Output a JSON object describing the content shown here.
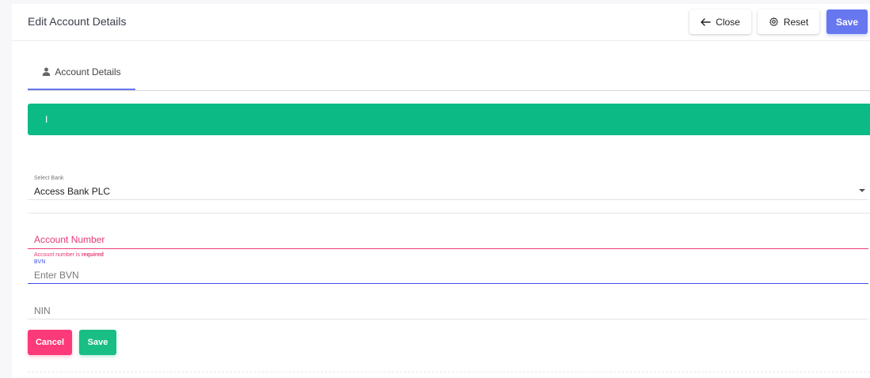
{
  "header": {
    "title": "Edit Account Details",
    "close_label": "Close",
    "reset_label": "Reset",
    "save_label": "Save"
  },
  "tabs": [
    {
      "label": "Account Details",
      "icon": "user-icon",
      "active": true
    }
  ],
  "banner": {
    "text": "I",
    "color": "#0cba86"
  },
  "form": {
    "bank": {
      "label": "Select Bank",
      "value": "Access Bank PLC"
    },
    "account_number": {
      "placeholder": "Account Number",
      "error_prefix": "Account number is ",
      "error_emphasis": "required"
    },
    "bvn": {
      "label": "BVN",
      "placeholder": "Enter BVN",
      "value": ""
    },
    "nin": {
      "placeholder": "NIN",
      "value": ""
    }
  },
  "actions": {
    "cancel_label": "Cancel",
    "save_label": "Save"
  },
  "colors": {
    "primary": "#6777ef",
    "success": "#0cba86",
    "danger": "#fc3a7a",
    "focus": "#3f51e8"
  }
}
